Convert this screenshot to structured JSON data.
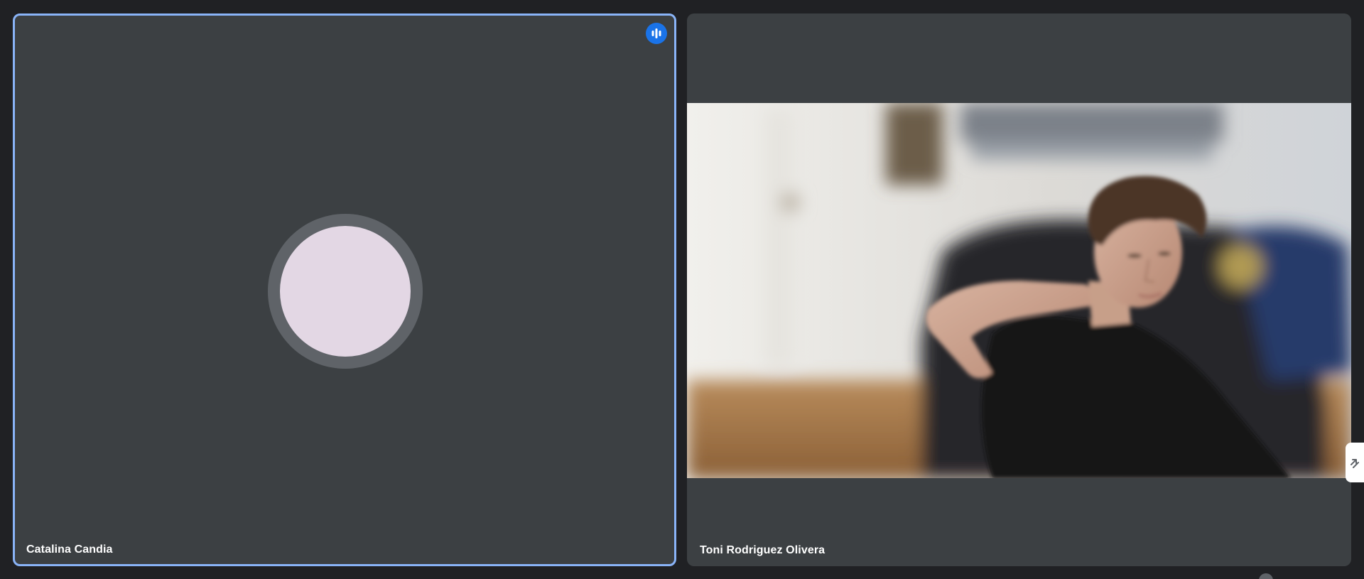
{
  "colors": {
    "page_background": "#202124",
    "tile_background": "#3c4043",
    "active_speaker_border": "#8ab4f8",
    "speaking_badge": "#1a73e8",
    "avatar_ring": "#5f6368",
    "avatar_fill": "#e3d7e4"
  },
  "participants": [
    {
      "name": "Catalina Candia",
      "camera": "off",
      "speaking": true,
      "indicator_icon": "audio-bars-icon"
    },
    {
      "name": "Toni Rodriguez Olivera",
      "camera": "on"
    }
  ],
  "icons": {
    "speaking_indicator": "audio-bars-icon",
    "side_panel_handle": "collapse-arrows-icon"
  }
}
